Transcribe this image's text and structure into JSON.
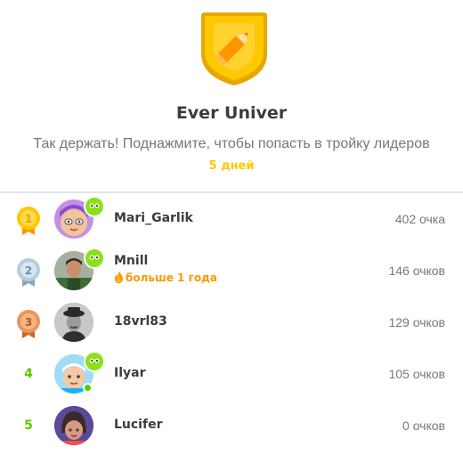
{
  "league": {
    "icon": "pencil-shield-icon",
    "name": "Ever Univer",
    "subtitle": "Так держать! Поднажмите, чтобы попасть в тройку лидеров",
    "days_left": "5 дней",
    "colors": {
      "gold": "#ffc800",
      "green": "#58cc02",
      "orange": "#ff9600"
    }
  },
  "leaderboard": [
    {
      "rank": "1",
      "rank_style": "gold-medal",
      "name": "Mari_Garlik",
      "xp": "402 очка",
      "has_owl_badge": true,
      "streak": ""
    },
    {
      "rank": "2",
      "rank_style": "silver-medal",
      "name": "Mnill",
      "xp": "146 очков",
      "has_owl_badge": true,
      "streak": "больше 1 года"
    },
    {
      "rank": "3",
      "rank_style": "bronze-medal",
      "name": "18vrl83",
      "xp": "129 очков",
      "has_owl_badge": false,
      "streak": ""
    },
    {
      "rank": "4",
      "rank_style": "number",
      "name": "Ilyar",
      "xp": "105 очков",
      "has_owl_badge": true,
      "streak": "",
      "online": true
    },
    {
      "rank": "5",
      "rank_style": "number",
      "name": "Lucifer",
      "xp": "0 очков",
      "has_owl_badge": false,
      "streak": ""
    }
  ]
}
